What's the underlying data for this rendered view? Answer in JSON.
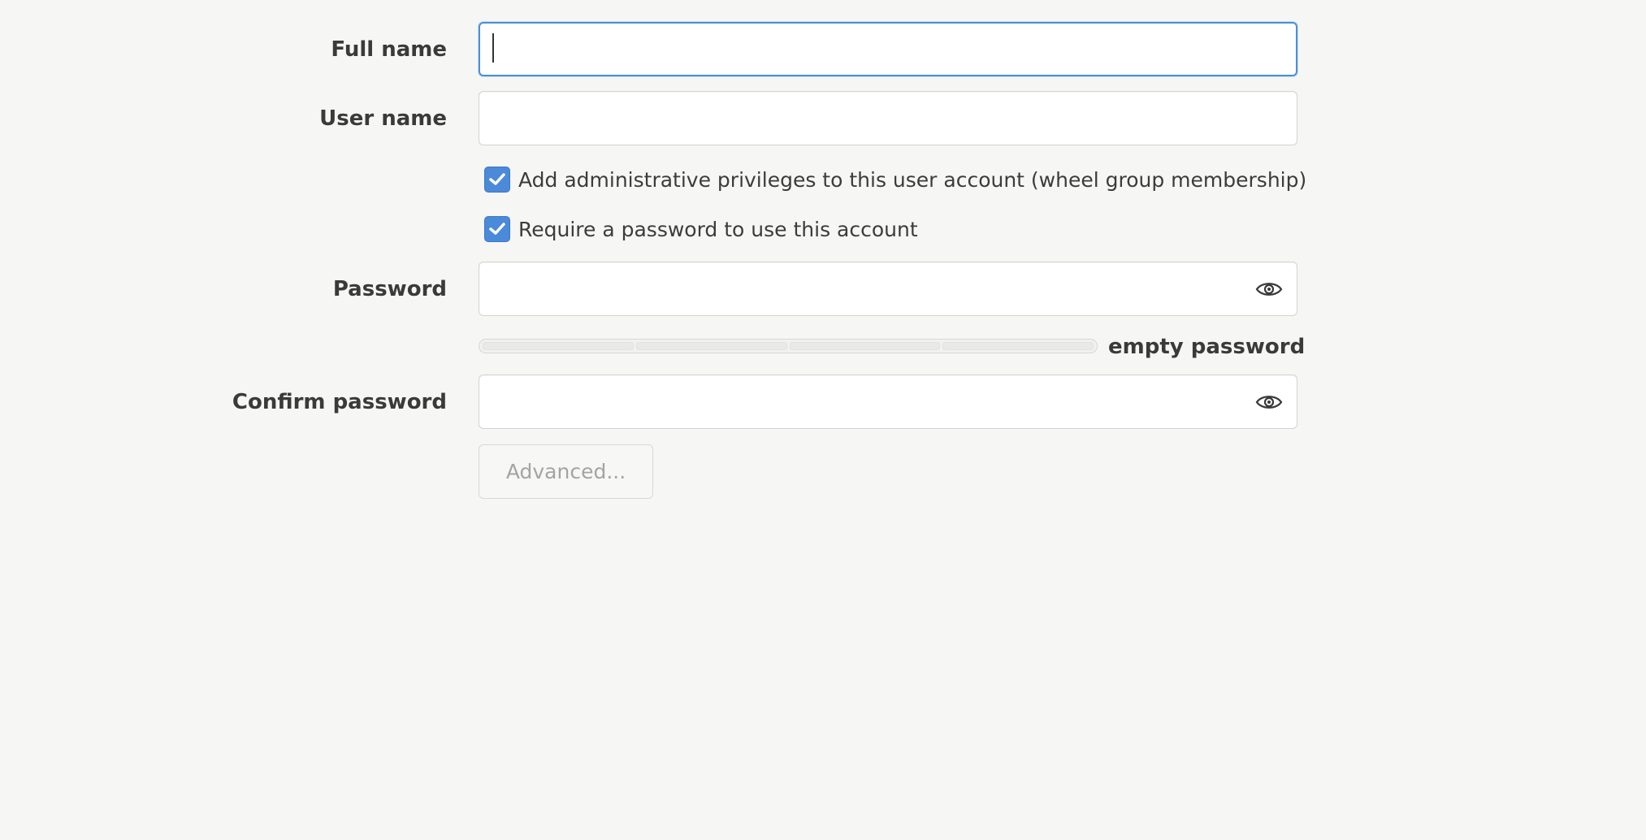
{
  "form": {
    "full_name": {
      "label": "Full name",
      "value": ""
    },
    "user_name": {
      "label": "User name",
      "value": ""
    },
    "admin_checkbox": {
      "label": "Add administrative privileges to this user account (wheel group membership)",
      "checked": true
    },
    "require_password_checkbox": {
      "label": "Require a password to use this account",
      "checked": true
    },
    "password": {
      "label": "Password",
      "value": "",
      "strength_text": "empty password",
      "strength_level": 0
    },
    "confirm_password": {
      "label": "Confirm password",
      "value": ""
    },
    "advanced_button": {
      "label": "Advanced..."
    }
  },
  "icons": {
    "reveal": "eye-icon",
    "check": "checkmark-icon"
  },
  "colors": {
    "accent": "#4a90d9",
    "checkbox": "#4a8ad8",
    "background": "#f6f6f5"
  }
}
